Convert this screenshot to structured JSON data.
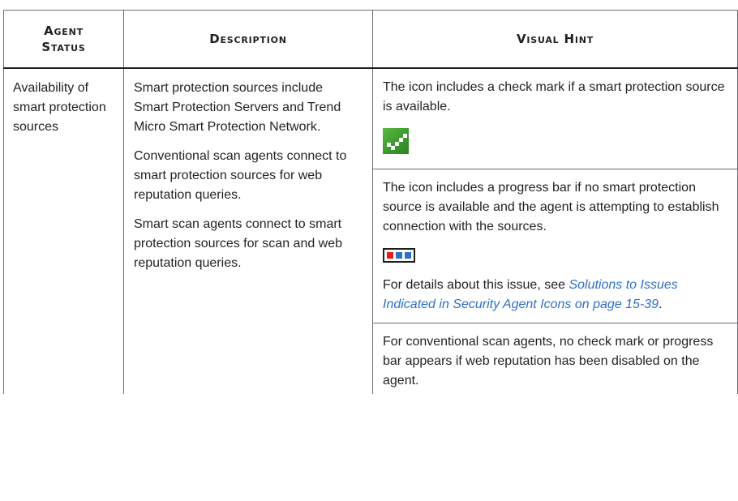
{
  "table": {
    "headers": {
      "col1_line1": "Agent",
      "col1_line2": "Status",
      "col2": "Description",
      "col3": "Visual Hint"
    },
    "row": {
      "status": "Availability of smart protection sources",
      "description": [
        "Smart protection sources include Smart Protection Servers and Trend Micro Smart Protection Network.",
        "Conventional scan agents connect to smart protection sources for web reputation queries.",
        "Smart scan agents connect to smart protection sources for scan and web reputation queries."
      ],
      "hints": {
        "available": "The icon includes a check mark if a smart protection source is available.",
        "progress": "The icon includes a progress bar if no smart protection source is available and the agent is attempting to establish connection with the sources.",
        "details_prefix": "For details about this issue, see ",
        "details_link": "Solutions to Issues Indicated in Security Agent Icons on page 15-39",
        "details_suffix": ".",
        "conventional": "For conventional scan agents, no check mark or progress bar appears if web reputation has been disabled on the agent."
      },
      "icons": {
        "available": "check-mark-icon",
        "progress": "progress-bar-icon"
      }
    }
  },
  "colors": {
    "link": "#2f6fc8",
    "check_green": "#3a9a2c",
    "progress_red": "#e61b1b",
    "progress_blue": "#2f6fc8"
  }
}
